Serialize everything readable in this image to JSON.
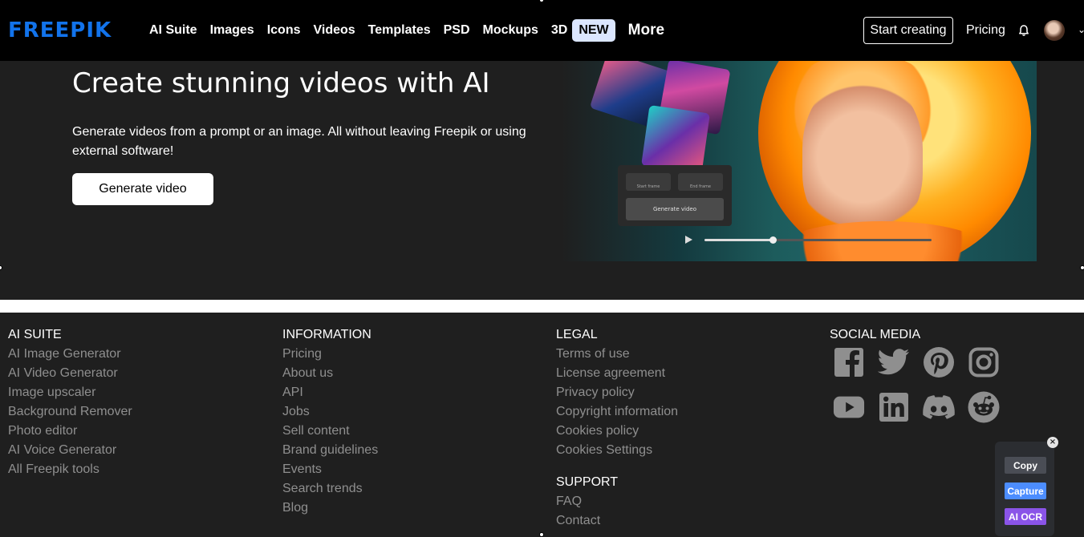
{
  "nav": {
    "logo": "FREEPIK",
    "links": [
      "AI Suite",
      "Images",
      "Icons",
      "Videos",
      "Templates",
      "PSD",
      "Mockups",
      "3D"
    ],
    "new_badge": "NEW",
    "more": "More",
    "start_creating": "Start creating",
    "pricing": "Pricing",
    "icons": {
      "bell": "bell-icon",
      "avatar": "avatar",
      "caret": "chevron-down-icon"
    }
  },
  "hero": {
    "title": "Create stunning videos with AI",
    "subtitle": "Generate videos from a prompt or an image. All without leaving Freepik or using external software!",
    "cta": "Generate video",
    "preview": {
      "start_frame": "Start frame",
      "end_frame": "End frame",
      "generate": "Generate video",
      "progress": 0.3
    }
  },
  "footer": {
    "ai_suite": {
      "title": "AI SUITE",
      "items": [
        "AI Image Generator",
        "AI Video Generator",
        "Image upscaler",
        "Background Remover",
        "Photo editor",
        "AI Voice Generator",
        "All Freepik tools"
      ]
    },
    "information": {
      "title": "INFORMATION",
      "items": [
        "Pricing",
        "About us",
        "API",
        "Jobs",
        "Sell content",
        "Brand guidelines",
        "Events",
        "Search trends",
        "Blog"
      ]
    },
    "legal": {
      "title": "LEGAL",
      "items": [
        "Terms of use",
        "License agreement",
        "Privacy policy",
        "Copyright information",
        "Cookies policy",
        "Cookies Settings"
      ]
    },
    "support": {
      "title": "SUPPORT",
      "items": [
        "FAQ",
        "Contact"
      ]
    },
    "social": {
      "title": "SOCIAL MEDIA",
      "icons": [
        "facebook-icon",
        "twitter-icon",
        "pinterest-icon",
        "instagram-icon",
        "youtube-icon",
        "linkedin-icon",
        "discord-icon",
        "reddit-icon"
      ]
    }
  },
  "extension": {
    "close": "×",
    "copy": "Copy",
    "capture": "Capture",
    "ai_ocr": "AI OCR"
  },
  "colors": {
    "brand": "#1273eb",
    "background": "#1f1f1f",
    "footer_link": "#8f8f8f",
    "capture": "#4c8dff",
    "ai_ocr": "#8a54e8"
  }
}
